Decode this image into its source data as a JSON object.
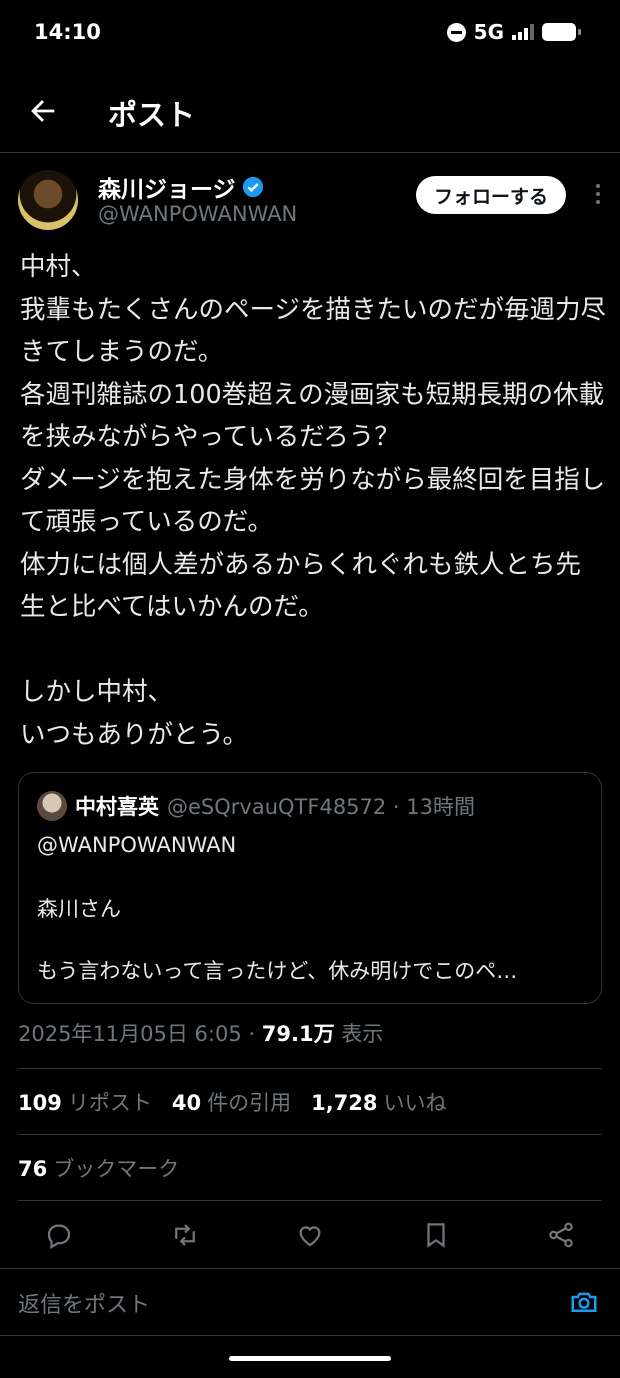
{
  "status_bar": {
    "time": "14:10",
    "network": "5G"
  },
  "header": {
    "title": "ポスト"
  },
  "author": {
    "name": "森川ジョージ",
    "handle": "@WANPOWANWAN",
    "follow_label": "フォローする"
  },
  "post": {
    "text": "中村、\n我輩もたくさんのページを描きたいのだが毎週力尽きてしまうのだ。\n各週刊雑誌の100巻超えの漫画家も短期長期の休載を挟みながらやっているだろう？\nダメージを抱えた身体を労りながら最終回を目指して頑張っているのだ。\n体力には個人差があるからくれぐれも鉄人とち先生と比べてはいかんのだ。\n\nしかし中村、\nいつもありがとう。"
  },
  "quote": {
    "name": "中村喜英",
    "handle_time": "@eSQrvauQTF48572 · 13時間",
    "text": "@WANPOWANWAN\n\n森川さん",
    "truncated": "もう言わないって言ったけど、休み明けでこのペ…"
  },
  "meta": {
    "datetime": "2025年11月05日 6:05 · ",
    "views": "79.1万",
    "views_label": " 表示"
  },
  "stats": {
    "reposts": "109",
    "reposts_label": "リポスト",
    "quotes": "40",
    "quotes_label": "件の引用",
    "likes": "1,728",
    "likes_label": "いいね",
    "bookmarks": "76",
    "bookmarks_label": "ブックマーク"
  },
  "reply": {
    "placeholder": "返信をポスト"
  },
  "colors": {
    "accent": "#1d9bf0",
    "background": "#000000",
    "muted": "#71767b",
    "border": "#2f3336"
  },
  "icons": [
    "back-arrow-icon",
    "verified-badge-icon",
    "more-icon",
    "reply-icon",
    "repost-icon",
    "like-icon",
    "bookmark-icon",
    "share-icon",
    "camera-icon"
  ]
}
